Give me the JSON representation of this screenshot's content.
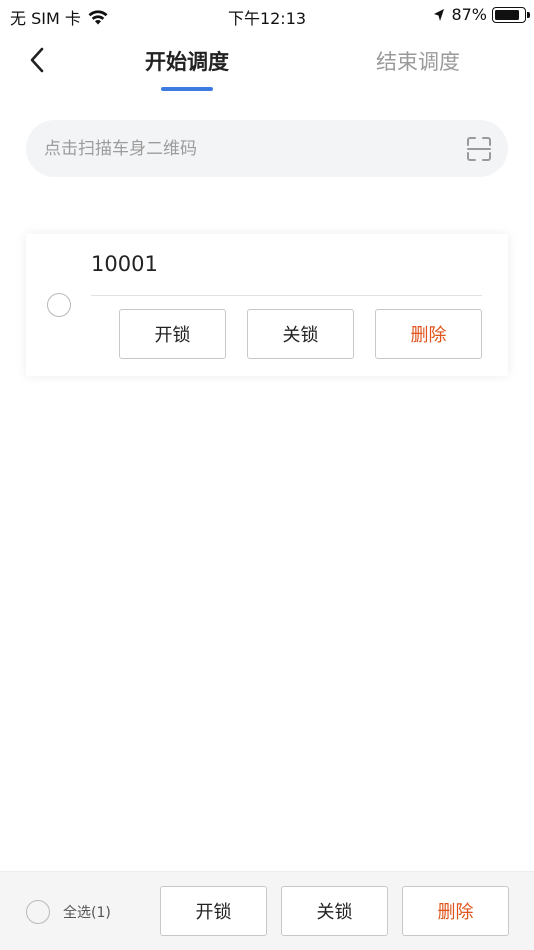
{
  "status_bar": {
    "carrier": "无 SIM 卡",
    "time": "下午12:13",
    "battery_percent": "87%",
    "battery_level": 0.87,
    "icons": [
      "wifi-icon",
      "location-arrow-icon",
      "battery-icon"
    ]
  },
  "nav": {
    "back_icon": "chevron-left-icon",
    "tabs": [
      {
        "label": "开始调度",
        "active": true
      },
      {
        "label": "结束调度",
        "active": false
      }
    ],
    "accent_color": "#3d7be0"
  },
  "search": {
    "placeholder": "点击扫描车身二维码",
    "value": "",
    "icon": "scan-qr-icon"
  },
  "vehicles": [
    {
      "id": "10001",
      "selected": false,
      "actions": {
        "unlock_label": "开锁",
        "lock_label": "关锁",
        "delete_label": "删除"
      }
    }
  ],
  "bottom_bar": {
    "select_all_label": "全选(1)",
    "unlock_label": "开锁",
    "lock_label": "关锁",
    "delete_label": "删除",
    "danger_color": "#e0541c"
  }
}
